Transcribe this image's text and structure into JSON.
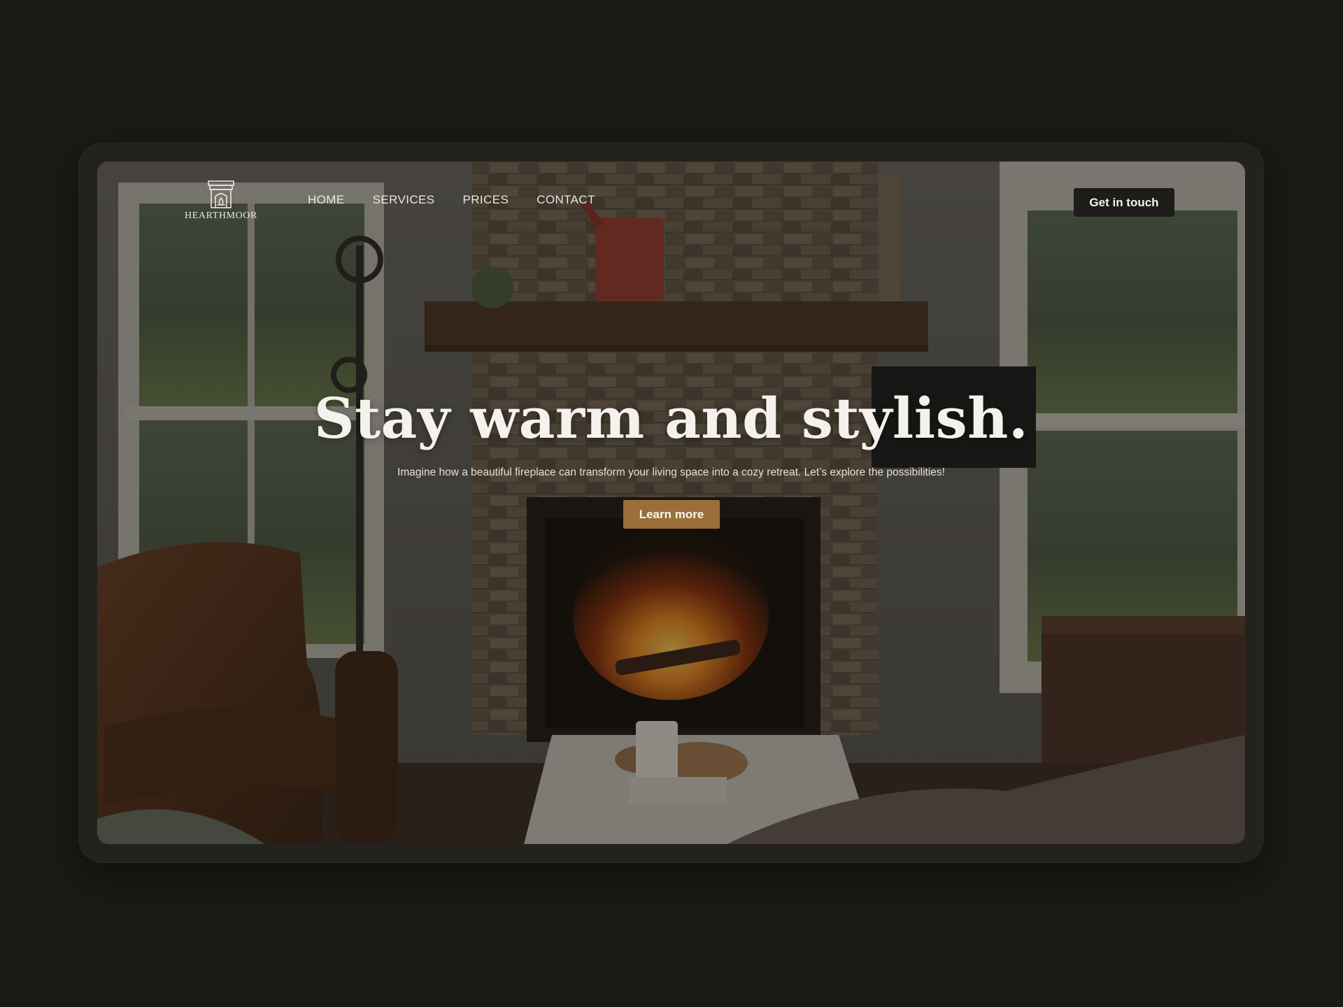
{
  "brand": {
    "name": "HEARTHMOOR",
    "logo_icon": "fireplace-icon"
  },
  "nav": {
    "items": [
      {
        "label": "HOME"
      },
      {
        "label": "SERVICES"
      },
      {
        "label": "PRICES"
      },
      {
        "label": "CONTACT"
      }
    ],
    "cta_label": "Get in touch"
  },
  "hero": {
    "title": "Stay warm and stylish.",
    "subtitle": "Imagine how a beautiful fireplace can transform your living space into a cozy retreat. Let’s explore the possibilities!",
    "button_label": "Learn more",
    "background": "living-room-fireplace-photo"
  },
  "colors": {
    "page_bg": "#1b1a16",
    "accent": "#9a7038",
    "cta_dark": "#1d1c19",
    "text_light": "#f5f2ed"
  }
}
